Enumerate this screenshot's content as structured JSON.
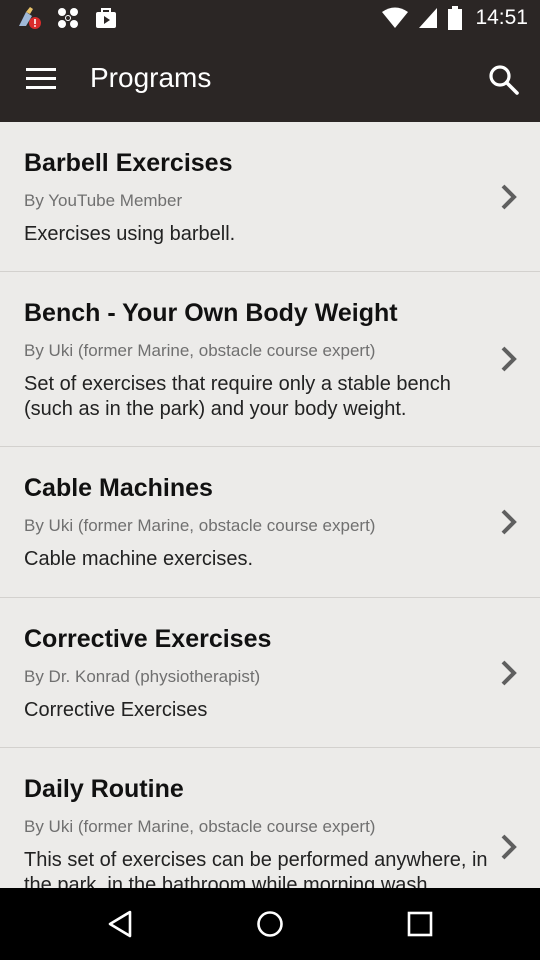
{
  "status_bar": {
    "time": "14:51",
    "left_icons": [
      "cleaner-notification-icon",
      "pinwheel-app-icon",
      "media-app-icon"
    ],
    "right_icons": [
      "wifi-icon",
      "cell-signal-icon",
      "battery-icon"
    ]
  },
  "app_bar": {
    "title": "Programs",
    "menu_icon": "hamburger-menu-icon",
    "search_icon": "search-icon"
  },
  "programs": [
    {
      "title": "Barbell Exercises",
      "author": "By YouTube Member",
      "description": "Exercises using barbell."
    },
    {
      "title": "Bench - Your Own Body Weight",
      "author": "By Uki (former Marine, obstacle course expert)",
      "description": "Set of exercises that require only a stable bench (such as in the park) and your body weight."
    },
    {
      "title": "Cable Machines",
      "author": "By Uki (former Marine, obstacle course expert)",
      "description": "Cable machine exercises."
    },
    {
      "title": "Corrective Exercises",
      "author": "By Dr. Konrad (physiotherapist)",
      "description": "Corrective Exercises"
    },
    {
      "title": "Daily Routine",
      "author": "By Uki (former Marine, obstacle course expert)",
      "description": "This set of exercises can be performed anywhere, in the park, in the bathroom while morning wash"
    }
  ],
  "nav_bar": {
    "buttons": [
      "back-icon",
      "home-icon",
      "recents-icon"
    ]
  },
  "colors": {
    "app_bar": "#2b2625",
    "background": "#ecebe9",
    "divider": "#d3d1ce",
    "title_text": "#111111",
    "author_text": "#707070",
    "chevron": "#5f5f5f"
  }
}
